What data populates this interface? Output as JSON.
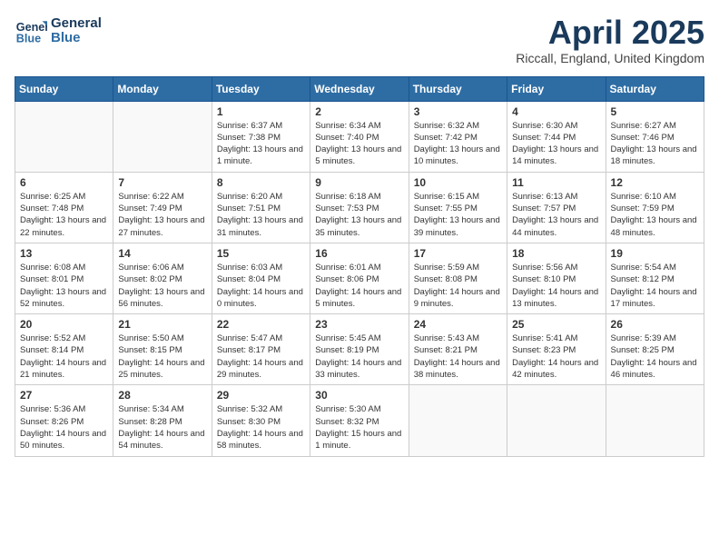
{
  "header": {
    "logo_line1": "General",
    "logo_line2": "Blue",
    "month_title": "April 2025",
    "location": "Riccall, England, United Kingdom"
  },
  "weekdays": [
    "Sunday",
    "Monday",
    "Tuesday",
    "Wednesday",
    "Thursday",
    "Friday",
    "Saturday"
  ],
  "weeks": [
    [
      {
        "day": "",
        "info": ""
      },
      {
        "day": "",
        "info": ""
      },
      {
        "day": "1",
        "info": "Sunrise: 6:37 AM\nSunset: 7:38 PM\nDaylight: 13 hours and 1 minute."
      },
      {
        "day": "2",
        "info": "Sunrise: 6:34 AM\nSunset: 7:40 PM\nDaylight: 13 hours and 5 minutes."
      },
      {
        "day": "3",
        "info": "Sunrise: 6:32 AM\nSunset: 7:42 PM\nDaylight: 13 hours and 10 minutes."
      },
      {
        "day": "4",
        "info": "Sunrise: 6:30 AM\nSunset: 7:44 PM\nDaylight: 13 hours and 14 minutes."
      },
      {
        "day": "5",
        "info": "Sunrise: 6:27 AM\nSunset: 7:46 PM\nDaylight: 13 hours and 18 minutes."
      }
    ],
    [
      {
        "day": "6",
        "info": "Sunrise: 6:25 AM\nSunset: 7:48 PM\nDaylight: 13 hours and 22 minutes."
      },
      {
        "day": "7",
        "info": "Sunrise: 6:22 AM\nSunset: 7:49 PM\nDaylight: 13 hours and 27 minutes."
      },
      {
        "day": "8",
        "info": "Sunrise: 6:20 AM\nSunset: 7:51 PM\nDaylight: 13 hours and 31 minutes."
      },
      {
        "day": "9",
        "info": "Sunrise: 6:18 AM\nSunset: 7:53 PM\nDaylight: 13 hours and 35 minutes."
      },
      {
        "day": "10",
        "info": "Sunrise: 6:15 AM\nSunset: 7:55 PM\nDaylight: 13 hours and 39 minutes."
      },
      {
        "day": "11",
        "info": "Sunrise: 6:13 AM\nSunset: 7:57 PM\nDaylight: 13 hours and 44 minutes."
      },
      {
        "day": "12",
        "info": "Sunrise: 6:10 AM\nSunset: 7:59 PM\nDaylight: 13 hours and 48 minutes."
      }
    ],
    [
      {
        "day": "13",
        "info": "Sunrise: 6:08 AM\nSunset: 8:01 PM\nDaylight: 13 hours and 52 minutes."
      },
      {
        "day": "14",
        "info": "Sunrise: 6:06 AM\nSunset: 8:02 PM\nDaylight: 13 hours and 56 minutes."
      },
      {
        "day": "15",
        "info": "Sunrise: 6:03 AM\nSunset: 8:04 PM\nDaylight: 14 hours and 0 minutes."
      },
      {
        "day": "16",
        "info": "Sunrise: 6:01 AM\nSunset: 8:06 PM\nDaylight: 14 hours and 5 minutes."
      },
      {
        "day": "17",
        "info": "Sunrise: 5:59 AM\nSunset: 8:08 PM\nDaylight: 14 hours and 9 minutes."
      },
      {
        "day": "18",
        "info": "Sunrise: 5:56 AM\nSunset: 8:10 PM\nDaylight: 14 hours and 13 minutes."
      },
      {
        "day": "19",
        "info": "Sunrise: 5:54 AM\nSunset: 8:12 PM\nDaylight: 14 hours and 17 minutes."
      }
    ],
    [
      {
        "day": "20",
        "info": "Sunrise: 5:52 AM\nSunset: 8:14 PM\nDaylight: 14 hours and 21 minutes."
      },
      {
        "day": "21",
        "info": "Sunrise: 5:50 AM\nSunset: 8:15 PM\nDaylight: 14 hours and 25 minutes."
      },
      {
        "day": "22",
        "info": "Sunrise: 5:47 AM\nSunset: 8:17 PM\nDaylight: 14 hours and 29 minutes."
      },
      {
        "day": "23",
        "info": "Sunrise: 5:45 AM\nSunset: 8:19 PM\nDaylight: 14 hours and 33 minutes."
      },
      {
        "day": "24",
        "info": "Sunrise: 5:43 AM\nSunset: 8:21 PM\nDaylight: 14 hours and 38 minutes."
      },
      {
        "day": "25",
        "info": "Sunrise: 5:41 AM\nSunset: 8:23 PM\nDaylight: 14 hours and 42 minutes."
      },
      {
        "day": "26",
        "info": "Sunrise: 5:39 AM\nSunset: 8:25 PM\nDaylight: 14 hours and 46 minutes."
      }
    ],
    [
      {
        "day": "27",
        "info": "Sunrise: 5:36 AM\nSunset: 8:26 PM\nDaylight: 14 hours and 50 minutes."
      },
      {
        "day": "28",
        "info": "Sunrise: 5:34 AM\nSunset: 8:28 PM\nDaylight: 14 hours and 54 minutes."
      },
      {
        "day": "29",
        "info": "Sunrise: 5:32 AM\nSunset: 8:30 PM\nDaylight: 14 hours and 58 minutes."
      },
      {
        "day": "30",
        "info": "Sunrise: 5:30 AM\nSunset: 8:32 PM\nDaylight: 15 hours and 1 minute."
      },
      {
        "day": "",
        "info": ""
      },
      {
        "day": "",
        "info": ""
      },
      {
        "day": "",
        "info": ""
      }
    ]
  ]
}
